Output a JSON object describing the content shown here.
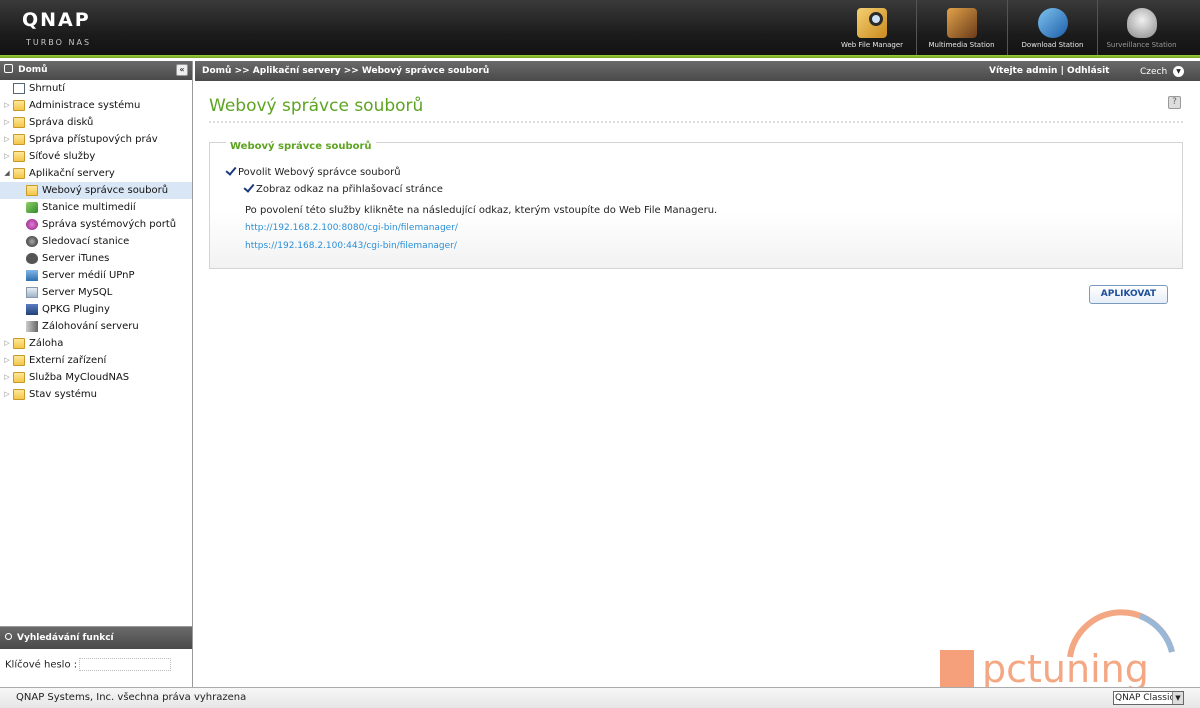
{
  "header": {
    "logo": "QNAP",
    "logo_sub": "TURBO NAS",
    "stations": [
      {
        "label": "Web File Manager",
        "icon": "web-file-manager-icon"
      },
      {
        "label": "Multimedia Station",
        "icon": "multimedia-station-icon"
      },
      {
        "label": "Download Station",
        "icon": "download-station-icon"
      },
      {
        "label": "Surveillance Station",
        "icon": "surveillance-station-icon"
      }
    ]
  },
  "sidebar": {
    "title": "Domů",
    "items": [
      {
        "label": "Shrnutí",
        "icon": "summary-icon"
      },
      {
        "label": "Administrace systému",
        "icon": "folder-icon"
      },
      {
        "label": "Správa disků",
        "icon": "folder-icon"
      },
      {
        "label": "Správa přístupových práv",
        "icon": "folder-icon"
      },
      {
        "label": "Síťové služby",
        "icon": "folder-icon"
      },
      {
        "label": "Aplikační servery",
        "icon": "folder-open-icon"
      },
      {
        "label": "Webový správce souborů",
        "icon": "folder-open-icon"
      },
      {
        "label": "Stanice multimedií",
        "icon": "multimedia-icon"
      },
      {
        "label": "Správa systémových portů",
        "icon": "port-icon"
      },
      {
        "label": "Sledovací stanice",
        "icon": "camera-icon"
      },
      {
        "label": "Server iTunes",
        "icon": "apple-icon"
      },
      {
        "label": "Server médií UPnP",
        "icon": "upnp-icon"
      },
      {
        "label": "Server MySQL",
        "icon": "mysql-icon"
      },
      {
        "label": "QPKG Pluginy",
        "icon": "qpkg-icon"
      },
      {
        "label": "Zálohování serveru",
        "icon": "backup-server-icon"
      },
      {
        "label": "Záloha",
        "icon": "folder-icon"
      },
      {
        "label": "Externí zařízení",
        "icon": "folder-icon"
      },
      {
        "label": "Služba MyCloudNAS",
        "icon": "folder-icon"
      },
      {
        "label": "Stav systému",
        "icon": "folder-icon"
      }
    ],
    "search_title": "Vyhledávání funkcí",
    "search_label": "Klíčové heslo :",
    "search_value": ""
  },
  "topbar": {
    "breadcrumb": "Domů >> Aplikační servery >> Webový správce souborů",
    "welcome": "Vítejte admin",
    "separator": "|",
    "logout": "Odhlásit",
    "language": "Czech"
  },
  "main": {
    "title": "Webový správce souborů",
    "section_title": "Webový správce souborů",
    "enable_label": "Povolit Webový správce souborů",
    "enable_checked": true,
    "show_link_label": "Zobraz odkaz na přihlašovací stránce",
    "show_link_checked": true,
    "info": "Po povolení této služby klikněte na následující odkaz, kterým vstoupíte do Web File Manageru.",
    "link_http": "http://192.168.2.100:8080/cgi-bin/filemanager/",
    "link_https": "https://192.168.2.100:443/cgi-bin/filemanager/",
    "apply_label": "APLIKOVAT"
  },
  "footer": {
    "copyright": "QNAP Systems, Inc. všechna práva vyhrazena",
    "theme": "QNAP Classic"
  },
  "watermark": {
    "text": "pctuning"
  },
  "colors": {
    "accent_green": "#5da421",
    "link_blue": "#2a8fd6",
    "selected_row": "#d9e6f5"
  }
}
